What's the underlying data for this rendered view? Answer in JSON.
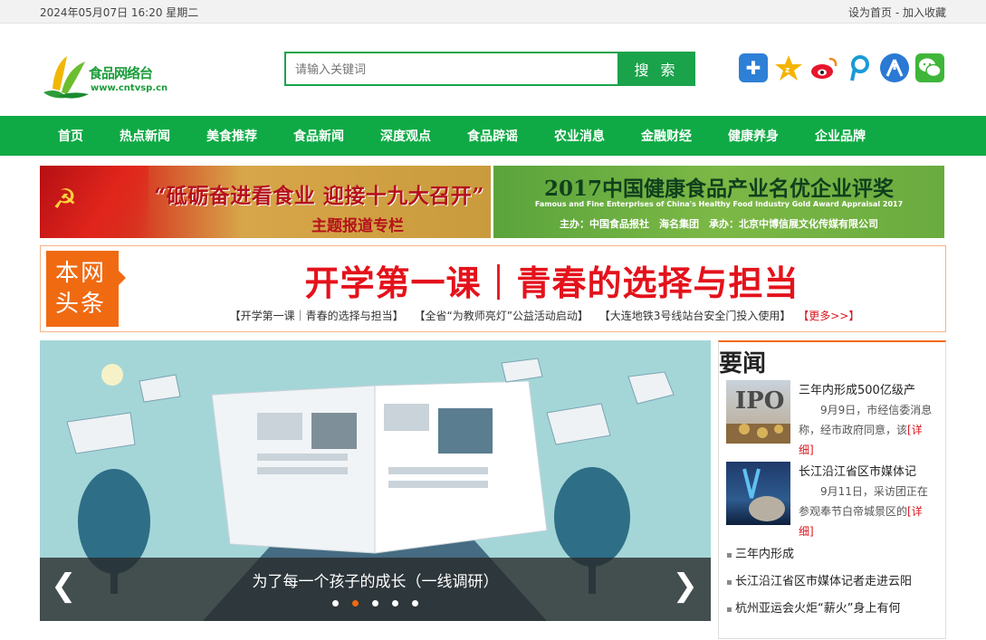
{
  "topbar": {
    "datetime": "2024年05月07日 16:20 星期二",
    "set_home": "设为首页",
    "sep": " - ",
    "bookmark": "加入收藏"
  },
  "logo": {
    "text": "食品网络台",
    "url": "www.cntvsp.cn"
  },
  "search": {
    "placeholder": "请输入关键词",
    "button": "搜 索"
  },
  "share_icons": [
    "plus-icon",
    "qzone-icon",
    "weibo-icon",
    "tencent-weibo-icon",
    "renren-icon",
    "wechat-icon"
  ],
  "nav": [
    "首页",
    "热点新闻",
    "美食推荐",
    "食品新闻",
    "深度观点",
    "食品辟谣",
    "农业消息",
    "金融财经",
    "健康养身",
    "企业品牌"
  ],
  "banner_left": {
    "title": "“砥砺奋进看食业 迎接十九大召开”",
    "subtitle": "主题报道专栏"
  },
  "banner_right": {
    "title": "2017中国健康食品产业名优企业评奖",
    "en": "Famous and Fine Enterprises of China's Healthy Food Industry Gold Award Appraisal 2017",
    "hosts": "主办：中国食品报社　海名集团　承办：北京中博信展文化传媒有限公司"
  },
  "headline": {
    "badge_line1": "本网",
    "badge_line2": "头条",
    "title": "开学第一课｜青春的选择与担当",
    "links": [
      "【开学第一课｜青春的选择与担当】",
      "【全省“为教师亮灯”公益活动启动】",
      "【大连地铁3号线站台安全门投入使用】"
    ],
    "more": "【更多>>】"
  },
  "slider": {
    "caption": "为了每一个孩子的成长（一线调研）",
    "dots": 5,
    "active": 1
  },
  "sidebar": {
    "title": "要闻",
    "news": [
      {
        "title": "三年内形成500亿级产",
        "desc": "9月9日，市经信委消息称，经市政府同意，该",
        "detail": "[详细]",
        "thumb_label": "IPO"
      },
      {
        "title": "长江沿江省区市媒体记",
        "desc": "9月11日，采访团正在参观奉节白帝城景区的",
        "detail": "[详细]"
      }
    ],
    "list": [
      "三年内形成",
      "长江沿江省区市媒体记者走进云阳",
      "杭州亚运会火炬“薪火”身上有何"
    ]
  }
}
